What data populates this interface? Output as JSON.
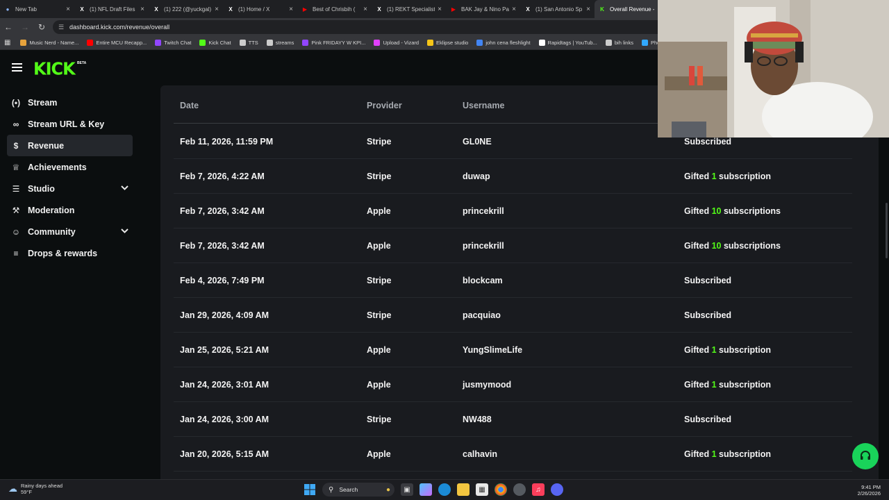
{
  "browser": {
    "tabs": [
      {
        "label": "New Tab",
        "icon": "chrome-icon",
        "color": "#8ab4f8"
      },
      {
        "label": "(1) NFL Draft Files",
        "icon": "x-icon",
        "color": "#ffffff"
      },
      {
        "label": "(1) 222 (@yuckgal)",
        "icon": "x-icon",
        "color": "#ffffff"
      },
      {
        "label": "(1) Home / X",
        "icon": "x-icon",
        "color": "#ffffff"
      },
      {
        "label": "Best of Chrisbih (",
        "icon": "youtube-icon",
        "color": "#ff0000"
      },
      {
        "label": "(1) REKT Specialist",
        "icon": "x-icon",
        "color": "#ffffff"
      },
      {
        "label": "BAK Jay & Nino Pa",
        "icon": "youtube-icon",
        "color": "#ff0000"
      },
      {
        "label": "(1) San Antonio Sp",
        "icon": "x-icon",
        "color": "#ffffff"
      },
      {
        "label": "Overall Revenue -",
        "icon": "kick-icon",
        "color": "#53fc18"
      }
    ],
    "url": "dashboard.kick.com/revenue/overall",
    "bookmarks": [
      {
        "label": "Music Nerd - Name...",
        "color": "#e6a23c"
      },
      {
        "label": "Entire MCU Recapp...",
        "color": "#ff0000"
      },
      {
        "label": "Twitch Chat",
        "color": "#9146ff"
      },
      {
        "label": "Kick Chat",
        "color": "#53fc18"
      },
      {
        "label": "TTS",
        "color": "#cccccc"
      },
      {
        "label": "streams",
        "color": "#cccccc"
      },
      {
        "label": "Pink FRIDAYY W KPI...",
        "color": "#9146ff"
      },
      {
        "label": "Upload - Vizard",
        "color": "#e040fb"
      },
      {
        "label": "Eklipse studio",
        "color": "#f5c518"
      },
      {
        "label": "john cena fleshlight",
        "color": "#4285f4"
      },
      {
        "label": "Rapidtags | YouTub...",
        "color": "#ffffff"
      },
      {
        "label": "bih links",
        "color": "#cccccc"
      },
      {
        "label": "Photop",
        "color": "#31a8ff"
      }
    ]
  },
  "app": {
    "logo": "KICK",
    "logo_badge": "BETA",
    "accent": "#53fc18"
  },
  "sidebar": {
    "items": [
      {
        "label": "Stream",
        "icon": "broadcast-icon",
        "active": false,
        "expandable": false
      },
      {
        "label": "Stream URL & Key",
        "icon": "link-icon",
        "active": false,
        "expandable": false
      },
      {
        "label": "Revenue",
        "icon": "dollar-icon",
        "active": true,
        "expandable": false
      },
      {
        "label": "Achievements",
        "icon": "trophy-icon",
        "active": false,
        "expandable": false
      },
      {
        "label": "Studio",
        "icon": "sliders-icon",
        "active": false,
        "expandable": true
      },
      {
        "label": "Moderation",
        "icon": "wrench-icon",
        "active": false,
        "expandable": false
      },
      {
        "label": "Community",
        "icon": "users-icon",
        "active": false,
        "expandable": true
      },
      {
        "label": "Drops & rewards",
        "icon": "chart-icon",
        "active": false,
        "expandable": false
      }
    ]
  },
  "table": {
    "columns": [
      "Date",
      "Provider",
      "Username"
    ],
    "rows": [
      {
        "date": "Feb 11, 2026, 11:59 PM",
        "provider": "Stripe",
        "username": "GL0NE",
        "pre": "Subscribed",
        "num": "",
        "post": ""
      },
      {
        "date": "Feb 7, 2026, 4:22 AM",
        "provider": "Stripe",
        "username": "duwap",
        "pre": "Gifted ",
        "num": "1",
        "post": " subscription"
      },
      {
        "date": "Feb 7, 2026, 3:42 AM",
        "provider": "Apple",
        "username": "princekrill",
        "pre": "Gifted ",
        "num": "10",
        "post": " subscriptions"
      },
      {
        "date": "Feb 7, 2026, 3:42 AM",
        "provider": "Apple",
        "username": "princekrill",
        "pre": "Gifted ",
        "num": "10",
        "post": " subscriptions"
      },
      {
        "date": "Feb 4, 2026, 7:49 PM",
        "provider": "Stripe",
        "username": "blockcam",
        "pre": "Subscribed",
        "num": "",
        "post": ""
      },
      {
        "date": "Jan 29, 2026, 4:09 AM",
        "provider": "Stripe",
        "username": "pacquiao",
        "pre": "Subscribed",
        "num": "",
        "post": ""
      },
      {
        "date": "Jan 25, 2026, 5:21 AM",
        "provider": "Apple",
        "username": "YungSlimeLife",
        "pre": "Gifted ",
        "num": "1",
        "post": " subscription"
      },
      {
        "date": "Jan 24, 2026, 3:01 AM",
        "provider": "Apple",
        "username": "jusmymood",
        "pre": "Gifted ",
        "num": "1",
        "post": " subscription"
      },
      {
        "date": "Jan 24, 2026, 3:00 AM",
        "provider": "Stripe",
        "username": "NW488",
        "pre": "Subscribed",
        "num": "",
        "post": ""
      },
      {
        "date": "Jan 20, 2026, 5:15 AM",
        "provider": "Apple",
        "username": "calhavin",
        "pre": "Gifted ",
        "num": "1",
        "post": " subscription"
      }
    ]
  },
  "taskbar": {
    "weather_title": "Rainy days ahead",
    "weather_temp": "59°F",
    "search_label": "Search",
    "time": "9:41 PM",
    "date": "2/26/2026"
  }
}
